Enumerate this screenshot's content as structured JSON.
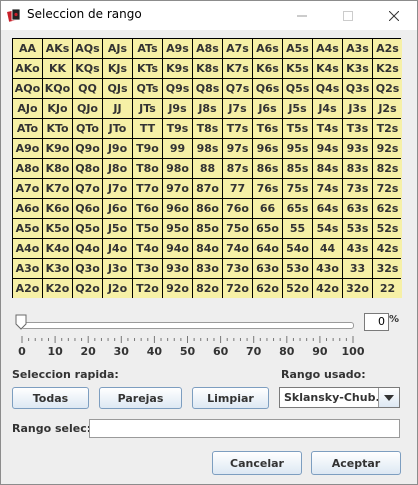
{
  "window": {
    "title": "Seleccion de rango"
  },
  "grid": {
    "rows": [
      [
        "AA",
        "AKs",
        "AQs",
        "AJs",
        "ATs",
        "A9s",
        "A8s",
        "A7s",
        "A6s",
        "A5s",
        "A4s",
        "A3s",
        "A2s"
      ],
      [
        "AKo",
        "KK",
        "KQs",
        "KJs",
        "KTs",
        "K9s",
        "K8s",
        "K7s",
        "K6s",
        "K5s",
        "K4s",
        "K3s",
        "K2s"
      ],
      [
        "AQo",
        "KQo",
        "QQ",
        "QJs",
        "QTs",
        "Q9s",
        "Q8s",
        "Q7s",
        "Q6s",
        "Q5s",
        "Q4s",
        "Q3s",
        "Q2s"
      ],
      [
        "AJo",
        "KJo",
        "QJo",
        "JJ",
        "JTs",
        "J9s",
        "J8s",
        "J7s",
        "J6s",
        "J5s",
        "J4s",
        "J3s",
        "J2s"
      ],
      [
        "ATo",
        "KTo",
        "QTo",
        "JTo",
        "TT",
        "T9s",
        "T8s",
        "T7s",
        "T6s",
        "T5s",
        "T4s",
        "T3s",
        "T2s"
      ],
      [
        "A9o",
        "K9o",
        "Q9o",
        "J9o",
        "T9o",
        "99",
        "98s",
        "97s",
        "96s",
        "95s",
        "94s",
        "93s",
        "92s"
      ],
      [
        "A8o",
        "K8o",
        "Q8o",
        "J8o",
        "T8o",
        "98o",
        "88",
        "87s",
        "86s",
        "85s",
        "84s",
        "83s",
        "82s"
      ],
      [
        "A7o",
        "K7o",
        "Q7o",
        "J7o",
        "T7o",
        "97o",
        "87o",
        "77",
        "76s",
        "75s",
        "74s",
        "73s",
        "72s"
      ],
      [
        "A6o",
        "K6o",
        "Q6o",
        "J6o",
        "T6o",
        "96o",
        "86o",
        "76o",
        "66",
        "65s",
        "64s",
        "63s",
        "62s"
      ],
      [
        "A5o",
        "K5o",
        "Q5o",
        "J5o",
        "T5o",
        "95o",
        "85o",
        "75o",
        "65o",
        "55",
        "54s",
        "53s",
        "52s"
      ],
      [
        "A4o",
        "K4o",
        "Q4o",
        "J4o",
        "T4o",
        "94o",
        "84o",
        "74o",
        "64o",
        "54o",
        "44",
        "43s",
        "42s"
      ],
      [
        "A3o",
        "K3o",
        "Q3o",
        "J3o",
        "T3o",
        "93o",
        "83o",
        "73o",
        "63o",
        "53o",
        "43o",
        "33",
        "32s"
      ],
      [
        "A2o",
        "K2o",
        "Q2o",
        "J2o",
        "T2o",
        "92o",
        "82o",
        "72o",
        "62o",
        "52o",
        "42o",
        "32o",
        "22"
      ]
    ],
    "cell_color": "#f6f0a6"
  },
  "slider": {
    "value": 0,
    "min": 0,
    "max": 100,
    "labels": [
      "0",
      "10",
      "20",
      "30",
      "40",
      "50",
      "60",
      "70",
      "80",
      "90",
      "100"
    ],
    "percent_value": "0",
    "percent_symbol": "%"
  },
  "quick_select": {
    "label": "Seleccion rapida:",
    "buttons": {
      "all": "Todas",
      "pairs": "Parejas",
      "clear": "Limpiar"
    }
  },
  "range_used": {
    "label": "Rango usado:",
    "selected": "Sklansky-Chub..."
  },
  "range_selected": {
    "label": "Rango selec:",
    "value": ""
  },
  "footer": {
    "cancel": "Cancelar",
    "accept": "Aceptar"
  },
  "icons": {
    "app": "poker-cards-icon",
    "minimize": "minimize-icon",
    "maximize": "maximize-icon",
    "close": "close-icon",
    "dropdown": "chevron-down-icon"
  }
}
